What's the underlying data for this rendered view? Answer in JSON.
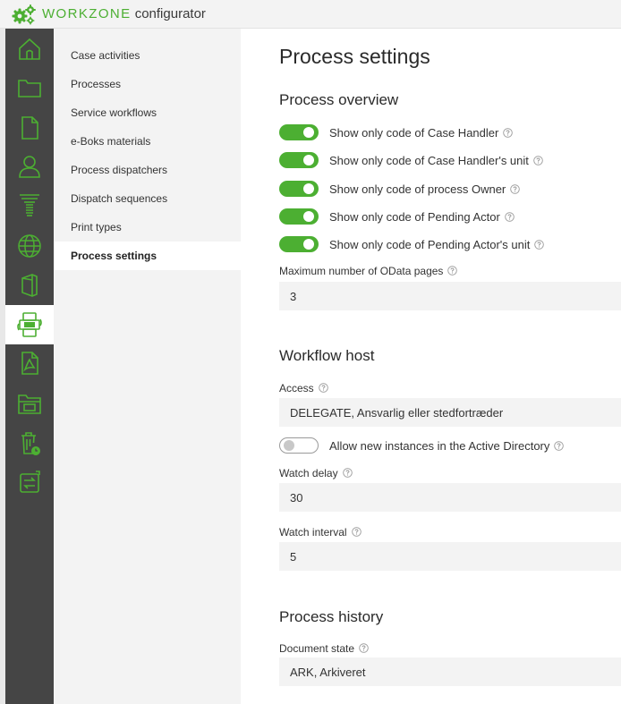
{
  "app": {
    "brand": "WORKZONE",
    "name": "configurator"
  },
  "iconbar": {
    "items": [
      {
        "name": "home-icon"
      },
      {
        "name": "folder-icon"
      },
      {
        "name": "document-icon"
      },
      {
        "name": "user-icon"
      },
      {
        "name": "filter-icon"
      },
      {
        "name": "globe-icon"
      },
      {
        "name": "office-icon"
      },
      {
        "name": "process-icon",
        "active": true
      },
      {
        "name": "pdf-icon"
      },
      {
        "name": "archive-folder-icon"
      },
      {
        "name": "trash-clock-icon"
      },
      {
        "name": "transfer-icon"
      }
    ]
  },
  "menu": {
    "items": [
      {
        "label": "Case activities"
      },
      {
        "label": "Processes"
      },
      {
        "label": "Service workflows"
      },
      {
        "label": "e-Boks materials"
      },
      {
        "label": "Process dispatchers"
      },
      {
        "label": "Dispatch sequences"
      },
      {
        "label": "Print types"
      },
      {
        "label": "Process settings",
        "active": true
      }
    ]
  },
  "main": {
    "title": "Process settings",
    "overview": {
      "heading": "Process overview",
      "toggles": [
        {
          "label": "Show only code of Case Handler",
          "on": true
        },
        {
          "label": "Show only code of Case Handler's unit",
          "on": true
        },
        {
          "label": "Show only code of process Owner",
          "on": true
        },
        {
          "label": "Show only code of Pending Actor",
          "on": true
        },
        {
          "label": "Show only code of Pending Actor's unit",
          "on": true
        }
      ],
      "max_pages_label": "Maximum number of OData pages",
      "max_pages_value": "3"
    },
    "workflow_host": {
      "heading": "Workflow host",
      "access_label": "Access",
      "access_value": "DELEGATE, Ansvarlig eller stedfortræder",
      "allow_label": "Allow new instances in the Active Directory",
      "allow_on": false,
      "watch_delay_label": "Watch delay",
      "watch_delay_value": "30",
      "watch_interval_label": "Watch interval",
      "watch_interval_value": "5"
    },
    "history": {
      "heading": "Process history",
      "doc_state_label": "Document state",
      "doc_state_value": "ARK, Arkiveret"
    }
  },
  "colors": {
    "accent": "#4caf32",
    "sidebar": "#454545",
    "menu_bg": "#f3f3f3"
  }
}
